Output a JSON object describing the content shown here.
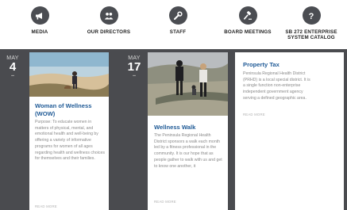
{
  "quicklinks": [
    {
      "label": "MEDIA",
      "icon": "megaphone-icon"
    },
    {
      "label": "OUR DIRECTORS",
      "icon": "people-icon"
    },
    {
      "label": "STAFF",
      "icon": "wrench-icon"
    },
    {
      "label": "BOARD MEETINGS",
      "icon": "gavel-icon"
    },
    {
      "label_line1": "SB 272 ENTERPRISE",
      "label_line2": "SYSTEM CATALOG",
      "icon": "question-icon"
    }
  ],
  "events": [
    {
      "month": "MAY",
      "day": "4",
      "title_line1": "Woman of Wellness",
      "title_line2": "(WOW)",
      "body": "Purpose: To educate women in matters of physical, mental, and emotional health and well-being by offering a variety of informative programs for women of all ages regarding health and wellness choices for themselves and their families.",
      "read_more": "READ MORE"
    },
    {
      "month": "MAY",
      "day": "17",
      "title": "Wellness Walk",
      "body": "The Peninsula Regional Health District sponsors a walk each month led by a fitness professional in the community. It is our hope that as people gather to walk with us and get to know one another, it",
      "read_more": "READ MORE"
    },
    {
      "title": "Property Tax",
      "body": "Peninsula Regional Health District (PRHD) is a local special district. It is a single function non-enterprise independent government agency serving a defined geographic area.",
      "read_more": "READ MORE"
    }
  ],
  "colors": {
    "strip": "#4a4b4f",
    "icon_circle": "#4b4d52",
    "title_blue": "#1f5a96"
  }
}
